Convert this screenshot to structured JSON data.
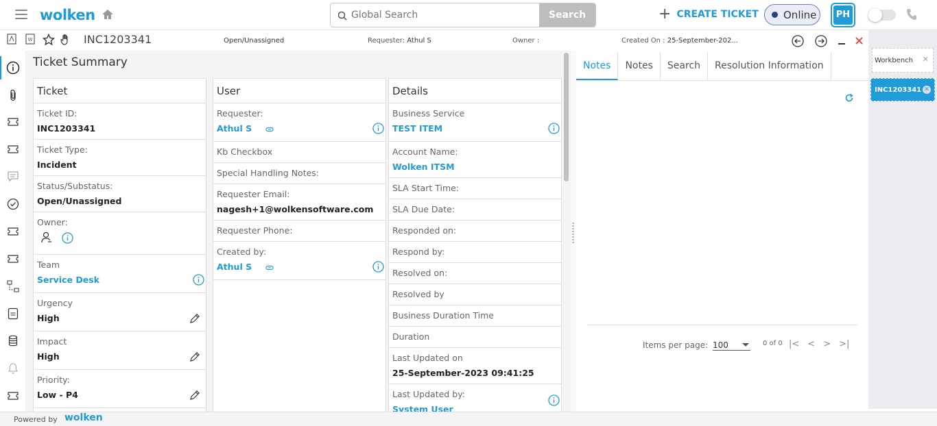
{
  "header": {
    "logo_text": "wolken",
    "search_placeholder": "Global Search",
    "search_button": "Search",
    "create_ticket": "CREATE TICKET",
    "status": "Online",
    "avatar_initials": "PH",
    "accent_color": "#1f9bd7"
  },
  "ribbon": {
    "ticket_id": "INC1203341",
    "status": "Open/Unassigned",
    "requester_label": "Requester:",
    "requester_value": "Athul S",
    "owner_label": "Owner :",
    "owner_value": "",
    "created_label": "Created On :",
    "created_value": "25-September-202..."
  },
  "main": {
    "title": "Ticket Summary",
    "ticket": {
      "header": "Ticket",
      "rows": [
        {
          "label": "Ticket ID:",
          "value": "INC1203341"
        },
        {
          "label": "Ticket Type:",
          "value": "Incident"
        },
        {
          "label": "Status/Substatus:",
          "value": "Open/Unassigned"
        },
        {
          "label": "Owner:",
          "value": ""
        },
        {
          "label": "Team",
          "value": "Service Desk"
        },
        {
          "label": "Urgency",
          "value": "High"
        },
        {
          "label": "Impact",
          "value": "High"
        },
        {
          "label": "Priority:",
          "value": "Low - P4"
        }
      ]
    },
    "user": {
      "header": "User",
      "rows": [
        {
          "label": "Requester:",
          "value": "Athul S"
        },
        {
          "label": "Kb Checkbox",
          "value": ""
        },
        {
          "label": "Special Handling Notes:",
          "value": ""
        },
        {
          "label": "Requester Email:",
          "value": "nagesh+1@wolkensoftware.com"
        },
        {
          "label": "Requester Phone:",
          "value": ""
        },
        {
          "label": "Created by:",
          "value": "Athul S"
        }
      ]
    },
    "details": {
      "header": "Details",
      "rows": [
        {
          "label": "Business Service",
          "value": "TEST ITEM"
        },
        {
          "label": "Account Name:",
          "value": "Wolken ITSM"
        },
        {
          "label": "SLA Start Time:",
          "value": ""
        },
        {
          "label": "SLA Due Date:",
          "value": ""
        },
        {
          "label": "Responded on:",
          "value": ""
        },
        {
          "label": "Respond by:",
          "value": ""
        },
        {
          "label": "Resolved on:",
          "value": ""
        },
        {
          "label": "Resolved by",
          "value": ""
        },
        {
          "label": "Business Duration Time",
          "value": ""
        },
        {
          "label": "Duration",
          "value": ""
        },
        {
          "label": "Last Updated on",
          "value": "25-September-2023 09:41:25"
        },
        {
          "label": "Last Updated by:",
          "value": "System User"
        }
      ]
    }
  },
  "right_panel": {
    "tabs": [
      "Notes",
      "Notes",
      "Search",
      "Resolution Information"
    ],
    "items_per_page_label": "Items per page:",
    "items_per_page_value": "100",
    "range": "0 of 0"
  },
  "workbench": {
    "title": "Workbench",
    "active_ticket": "INC1203341"
  },
  "footer": {
    "powered_by": "Powered by",
    "logo_text": "wolken"
  }
}
